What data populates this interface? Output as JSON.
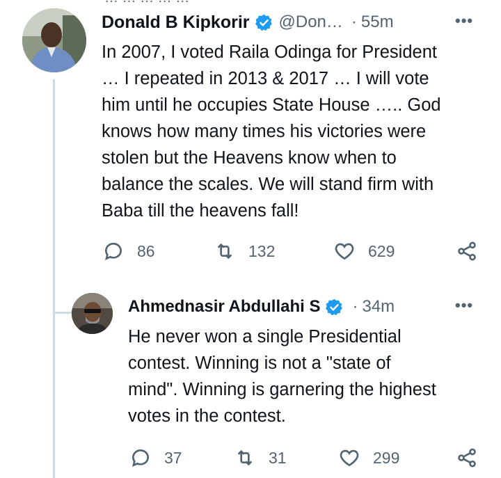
{
  "top_fragment": "…  …  …  …  … ",
  "tweet": {
    "author_name": "Donald B Kipkorir",
    "handle": "@Don…",
    "separator": "·",
    "time": "55m",
    "more": "•••",
    "lines": [
      "In 2007, I voted Raila Odinga for President",
      "… I repeated in 2013 & 2017 … I will vote",
      "him until he occupies State House ….. God",
      "knows how many times his victories were",
      "stolen but the Heavens know when to",
      "balance the scales. We will stand firm with",
      "Baba till the heavens fall!"
    ],
    "replies": "86",
    "retweets": "132",
    "likes": "629"
  },
  "reply": {
    "author_name": "Ahmednasir Abdullahi S",
    "separator": "·",
    "time": "34m",
    "more": "•••",
    "lines": [
      "He never won a single Presidential",
      "contest. Winning is not a \"state of",
      "mind\". Winning is garnering  the highest",
      "votes in the contest."
    ],
    "replies": "37",
    "retweets": "31",
    "likes": "299"
  },
  "colors": {
    "text": "#0f1419",
    "secondary": "#536471",
    "verified": "#1d9bf0",
    "thread_line": "#cfd9de"
  },
  "icons": [
    "reply-icon",
    "retweet-icon",
    "like-icon",
    "share-icon",
    "verified-badge-icon",
    "more-icon"
  ]
}
